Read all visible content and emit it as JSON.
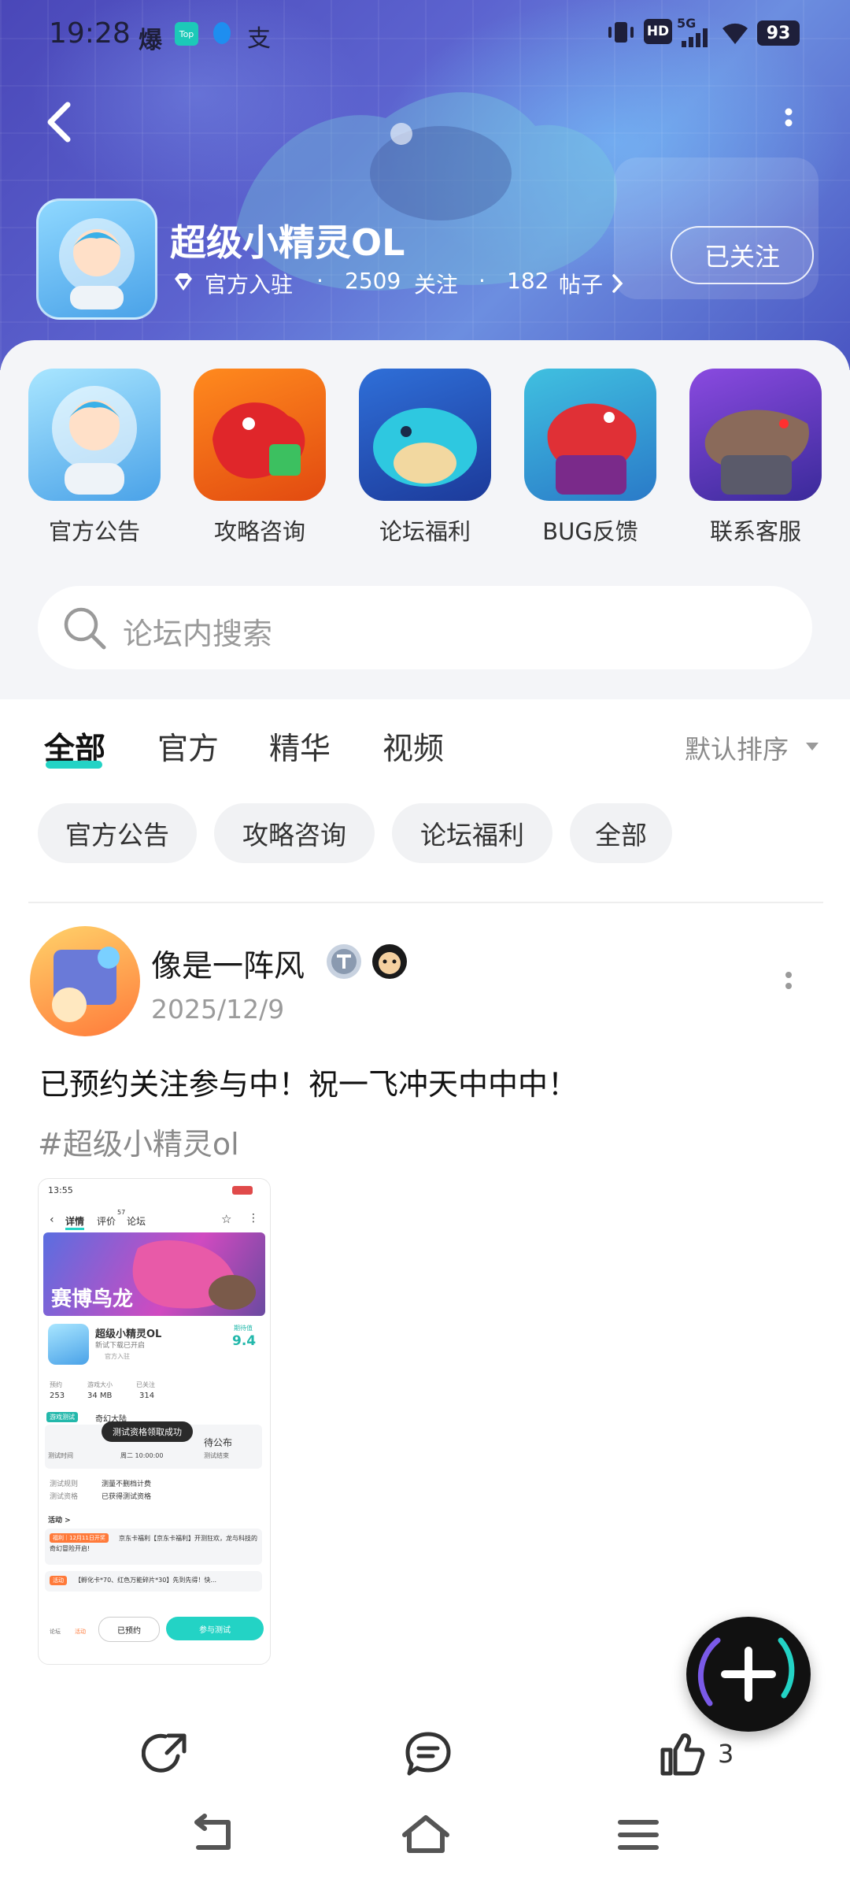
{
  "status_bar": {
    "time": "19:28",
    "notif_1": "爆",
    "notif_2": "Top",
    "notif_4": "支",
    "network": "5G",
    "hd": "HD",
    "battery": "93"
  },
  "header": {
    "forum_name": "超级小精灵OL",
    "verified_label": "官方入驻",
    "followers": "2509",
    "followers_label": "关注",
    "posts": "182",
    "posts_label": "帖子",
    "follow_button": "已关注"
  },
  "categories": [
    {
      "label": "官方公告"
    },
    {
      "label": "攻略咨询"
    },
    {
      "label": "论坛福利"
    },
    {
      "label": "BUG反馈"
    },
    {
      "label": "联系客服"
    }
  ],
  "search": {
    "placeholder": "论坛内搜索"
  },
  "tabs": [
    {
      "label": "全部",
      "active": true
    },
    {
      "label": "官方"
    },
    {
      "label": "精华"
    },
    {
      "label": "视频"
    }
  ],
  "sort_label": "默认排序",
  "chips": [
    {
      "label": "官方公告"
    },
    {
      "label": "攻略咨询"
    },
    {
      "label": "论坛福利"
    },
    {
      "label": "全部"
    }
  ],
  "post": {
    "username": "像是一阵风",
    "date": "2025/12/9",
    "text": "已预约关注参与中！祝一飞冲天中中中！",
    "tag": "#超级小精灵ol",
    "screenshot": {
      "time": "13:55",
      "tab_detail": "详情",
      "tab_review": "评价",
      "review_count": "57",
      "tab_forum": "论坛",
      "banner_text": "赛博鸟龙",
      "app_name": "超级小精灵OL",
      "app_sub": "新试下载已开启",
      "app_official": "官方入驻",
      "score_label": "期待值",
      "score": "9.4",
      "stat_1_label": "预约",
      "stat_1_value": "253",
      "stat_2_label": "游戏大小",
      "stat_2_value": "34 MB",
      "stat_3_label": "已关注",
      "stat_3_value": "314",
      "test_badge": "游戏测试",
      "test_name": "奇幻大陆",
      "toast": "测试资格领取成功",
      "test_time_label": "测试时间",
      "test_time_value": "周二 10:00:00",
      "test_status_1": "待公布",
      "test_status_2": "测试结束",
      "rule_label": "测试规则",
      "rule_value": "测量不删档计费",
      "qual_label": "测试资格",
      "qual_value": "已获得测试资格",
      "activity_title": "活动 >",
      "activity_1_badge": "福利｜12月11日开奖",
      "activity_1_text": "京东卡福利【京东卡福利】开测狂欢，龙与科技的奇幻冒险开启!",
      "activity_2_badge": "活动",
      "activity_2_text": "【孵化卡*70、红色万能碎片*30】先到先得！快...",
      "bottom_1": "论坛",
      "bottom_2": "活动",
      "btn_reserved": "已预约",
      "btn_join": "参与测试"
    }
  },
  "actions": {
    "like_count": "3"
  },
  "colors": {
    "accent": "#23d3c5",
    "hero_start": "#4a47b8",
    "hero_end": "#6c8ee0"
  }
}
